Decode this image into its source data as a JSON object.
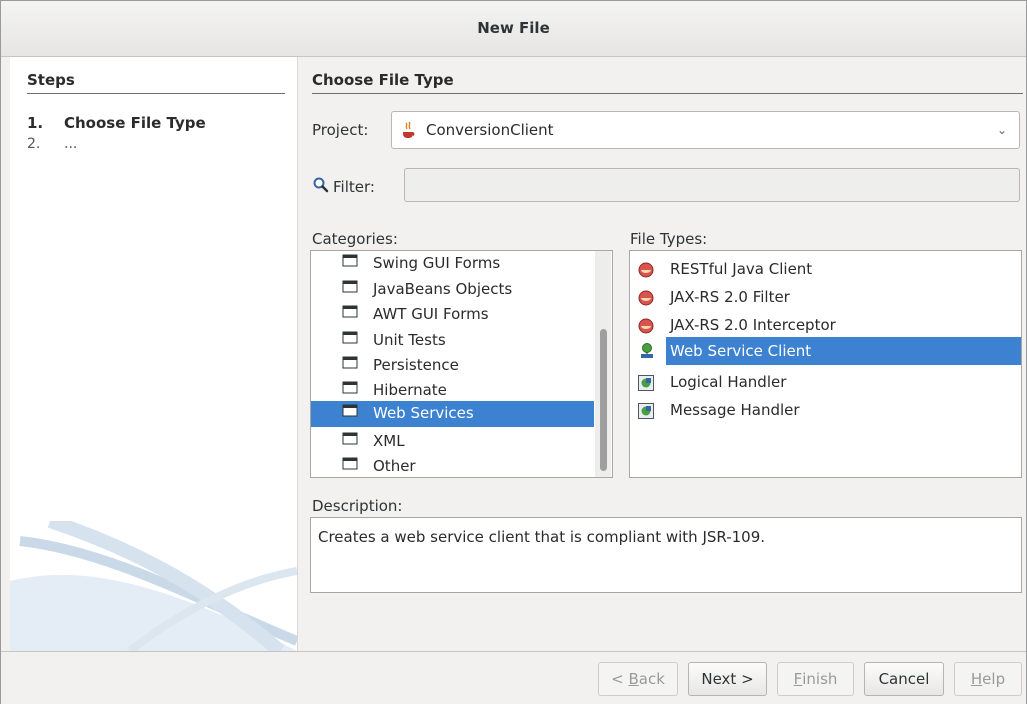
{
  "window": {
    "title": "New File"
  },
  "steps": {
    "header": "Steps",
    "items": [
      {
        "number": "1.",
        "label": "Choose File Type"
      },
      {
        "number": "2.",
        "label": "..."
      }
    ]
  },
  "main": {
    "header": "Choose File Type",
    "project_label": "Project:",
    "project_value": "ConversionClient",
    "filter_label": "Filter:",
    "filter_value": "",
    "categories_label": "Categories:",
    "categories": [
      "Swing GUI Forms",
      "JavaBeans Objects",
      "AWT GUI Forms",
      "Unit Tests",
      "Persistence",
      "Hibernate",
      "Web Services",
      "XML",
      "Other"
    ],
    "selected_category": "Web Services",
    "file_types_label": "File Types:",
    "file_types": [
      {
        "label": "RESTful Java Client",
        "icon": "rest-client-icon"
      },
      {
        "label": "JAX-RS 2.0 Filter",
        "icon": "jaxrs-filter-icon"
      },
      {
        "label": "JAX-RS 2.0 Interceptor",
        "icon": "jaxrs-interceptor-icon"
      },
      {
        "label": "Web Service Client",
        "icon": "web-service-client-icon"
      },
      {
        "label": "Logical Handler",
        "icon": "handler-icon"
      },
      {
        "label": "Message Handler",
        "icon": "handler-icon"
      }
    ],
    "selected_file_type": "Web Service Client",
    "description_label": "Description:",
    "description": "Creates a web service client that is compliant with JSR-109."
  },
  "buttons": {
    "back": {
      "prefix": "< ",
      "mnemonic": "B",
      "rest": "ack",
      "enabled": false
    },
    "next": {
      "label": "Next >",
      "enabled": true
    },
    "finish": {
      "mnemonic": "F",
      "rest": "inish",
      "enabled": false
    },
    "cancel": {
      "label": "Cancel",
      "enabled": true
    },
    "help": {
      "mnemonic": "H",
      "rest": "elp",
      "enabled": false
    }
  },
  "colors": {
    "selection": "#3c82d0",
    "accent_icon": "#c0392b"
  }
}
